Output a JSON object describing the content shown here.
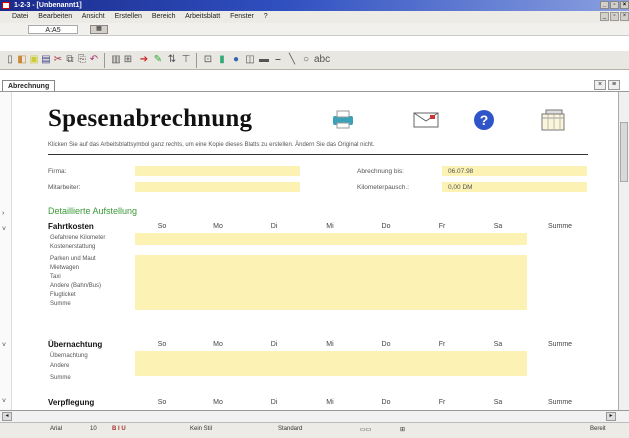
{
  "window": {
    "title": "1-2-3 - [Unbenannt1]",
    "controls": [
      "_",
      "▫",
      "×"
    ]
  },
  "menu": [
    "Datei",
    "Bearbeiten",
    "Ansicht",
    "Erstellen",
    "Bereich",
    "Arbeitsblatt",
    "Fenster",
    "?"
  ],
  "formula": {
    "cell": "A:A5"
  },
  "sheet_tab": "Abrechnung",
  "form": {
    "title": "Spesenabrechnung",
    "instruction": "Klicken Sie auf das Arbeitsblattsymbol ganz rechts, um eine Kopie dieses Blatts zu erstellen. Ändern Sie das Original nicht.",
    "labels": {
      "firma": "Firma:",
      "mitarbeiter": "Mitarbeiter:",
      "abrechnung_bis": "Abrechnung bis:",
      "km_pauschale": "Kilometerpausch.:"
    },
    "values": {
      "abrechnung_bis": "06.07.98",
      "km_pauschale": "0,00 DM"
    },
    "detail_heading": "Detaillierte Aufstellung"
  },
  "days": [
    "So",
    "Mo",
    "Di",
    "Mi",
    "Do",
    "Fr",
    "Sa",
    "Summe"
  ],
  "sections": [
    {
      "title": "Fahrtkosten",
      "rows": [
        "Gefahrene Kilometer",
        "Kostenerstattung",
        "Parken und Maut",
        "Mietwagen",
        "Taxi",
        "Andere (Bahn/Bus)",
        "Flugticket",
        "Summe"
      ]
    },
    {
      "title": "Übernachtung",
      "rows": [
        "Übernachtung",
        "Andere",
        "Summe"
      ]
    },
    {
      "title": "Verpflegung",
      "rows": []
    }
  ],
  "status": {
    "font": "Arial",
    "size": "10",
    "color_label": "Kein Stil",
    "format": "Standard",
    "mode": "Bereit"
  }
}
